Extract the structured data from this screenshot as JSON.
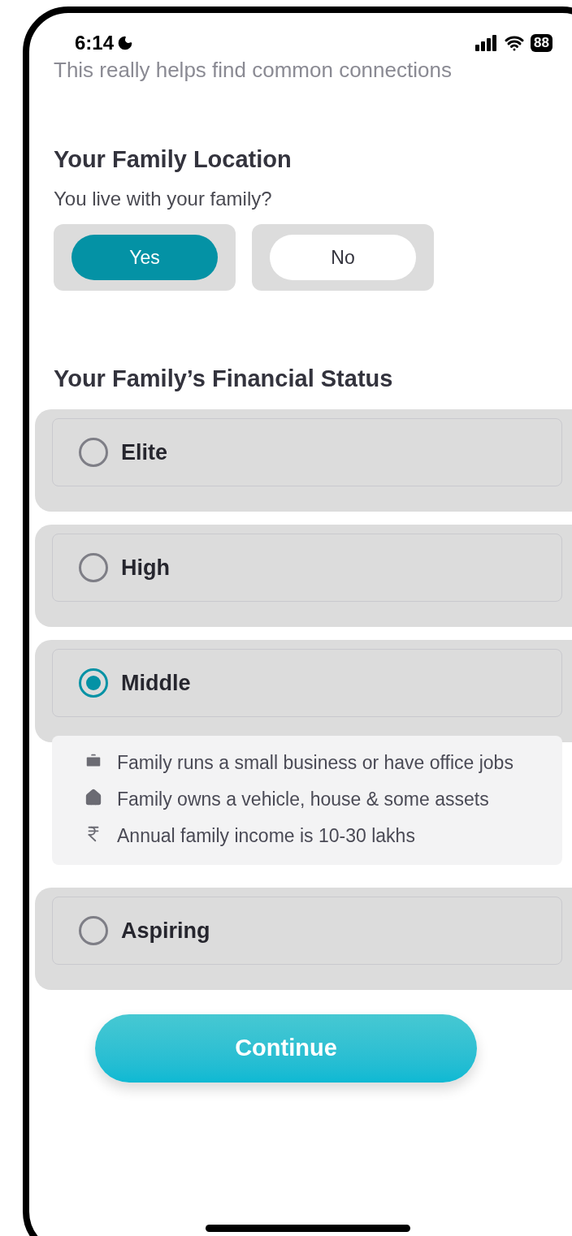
{
  "status_bar": {
    "time": "6:14",
    "battery": "88"
  },
  "subtitle": "This really helps find common connections",
  "location": {
    "title": "Your Family Location",
    "question": "You live with your family?",
    "options": [
      {
        "label": "Yes",
        "selected": true
      },
      {
        "label": "No",
        "selected": false
      }
    ]
  },
  "financial": {
    "title": "Your Family’s Financial Status",
    "options": [
      {
        "label": "Elite",
        "selected": false
      },
      {
        "label": "High",
        "selected": false
      },
      {
        "label": "Middle",
        "selected": true,
        "details": [
          {
            "kind": "briefcase",
            "text": "Family runs a small business or have office jobs"
          },
          {
            "kind": "home",
            "text": "Family owns a vehicle, house & some assets"
          },
          {
            "kind": "rupee",
            "text": "Annual family income is 10-30 lakhs"
          }
        ]
      },
      {
        "label": "Aspiring",
        "selected": false
      }
    ]
  },
  "continue_button": "Continue"
}
